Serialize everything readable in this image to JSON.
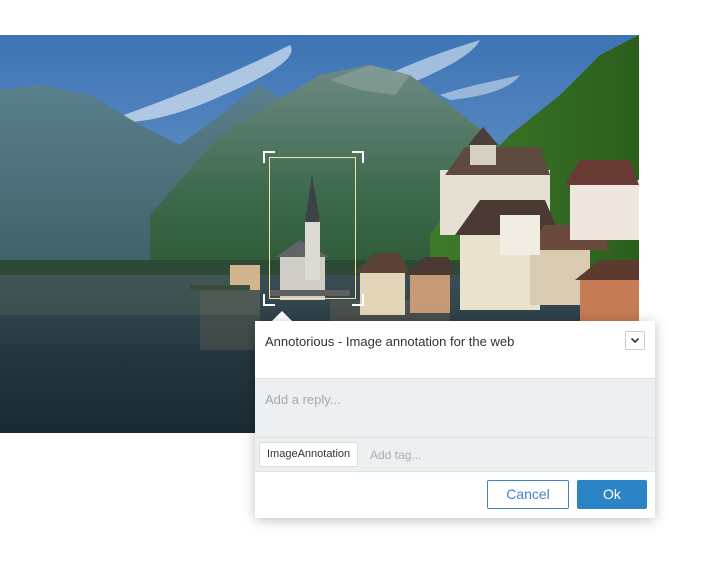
{
  "annotation": {
    "comment": "Annotorious - Image annotation for the web",
    "reply_placeholder": "Add a reply...",
    "tags": [
      "ImageAnnotation"
    ],
    "tag_placeholder": "Add tag...",
    "cancel_label": "Cancel",
    "ok_label": "Ok"
  },
  "colors": {
    "accent": "#2a84c6",
    "selection_border": "#f2e49b",
    "panel_bg": "#ecf0f1"
  },
  "icons": {
    "dropdown": "chevron-down-icon"
  }
}
